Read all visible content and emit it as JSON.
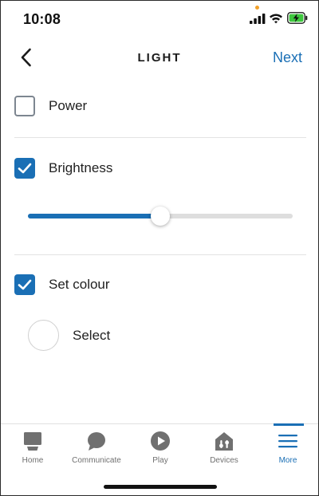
{
  "status_bar": {
    "time": "10:08",
    "icons": [
      "signal-icon",
      "wifi-icon",
      "battery-charging-icon"
    ]
  },
  "header": {
    "back_icon": "chevron-left-icon",
    "title": "LIGHT",
    "next_label": "Next"
  },
  "options": {
    "power": {
      "label": "Power",
      "checked": false
    },
    "brightness": {
      "label": "Brightness",
      "checked": true,
      "level_fraction": 0.5
    },
    "set_colour": {
      "label": "Set colour",
      "checked": true
    }
  },
  "colour_select": {
    "label": "Select"
  },
  "bottom_nav": {
    "items": [
      {
        "label": "Home",
        "icon": "home-echo-icon",
        "active": false
      },
      {
        "label": "Communicate",
        "icon": "chat-bubble-icon",
        "active": false
      },
      {
        "label": "Play",
        "icon": "play-icon",
        "active": false
      },
      {
        "label": "Devices",
        "icon": "devices-house-icon",
        "active": false
      },
      {
        "label": "More",
        "icon": "menu-icon",
        "active": true
      }
    ]
  },
  "colors": {
    "accent": "#1a6fb5",
    "inactive_nav": "#707070",
    "checkbox_border": "#7d8690",
    "track": "#dedede"
  }
}
